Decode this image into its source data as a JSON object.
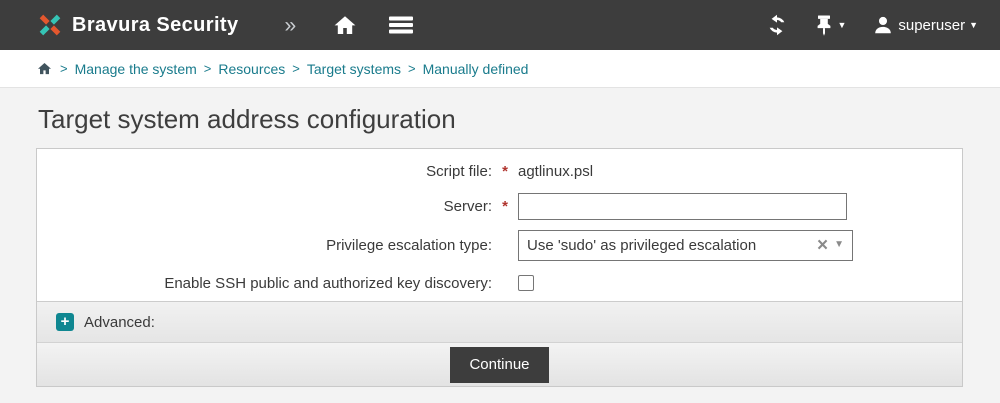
{
  "header": {
    "brand": "Bravura Security",
    "user": "superuser"
  },
  "icons": {
    "double_chevron": "»",
    "caret_down": "▼",
    "clear_x": "×",
    "plus": "+",
    "crumb_separator": ">"
  },
  "breadcrumb": {
    "items": [
      "Manage the system",
      "Resources",
      "Target systems",
      "Manually defined"
    ]
  },
  "page": {
    "title": "Target system address configuration"
  },
  "form": {
    "script_file": {
      "label": "Script file:",
      "required": "*",
      "value": "agtlinux.psl"
    },
    "server": {
      "label": "Server:",
      "required": "*",
      "input_value": ""
    },
    "priv_escalation": {
      "label": "Privilege escalation type:",
      "selected": "Use 'sudo' as privileged escalation"
    },
    "ssh_discovery": {
      "label": "Enable SSH public and authorized key discovery:",
      "checked": false
    },
    "advanced_label": "Advanced:",
    "continue_label": "Continue"
  },
  "colors": {
    "header_bg": "#3d3d3d",
    "accent_teal": "#0f8791",
    "breadcrumb_link": "#197b8c",
    "logo_orange": "#e4572e",
    "logo_teal": "#35c4b5",
    "required_red": "#b0342e",
    "button_bg": "#3d3d3d"
  }
}
